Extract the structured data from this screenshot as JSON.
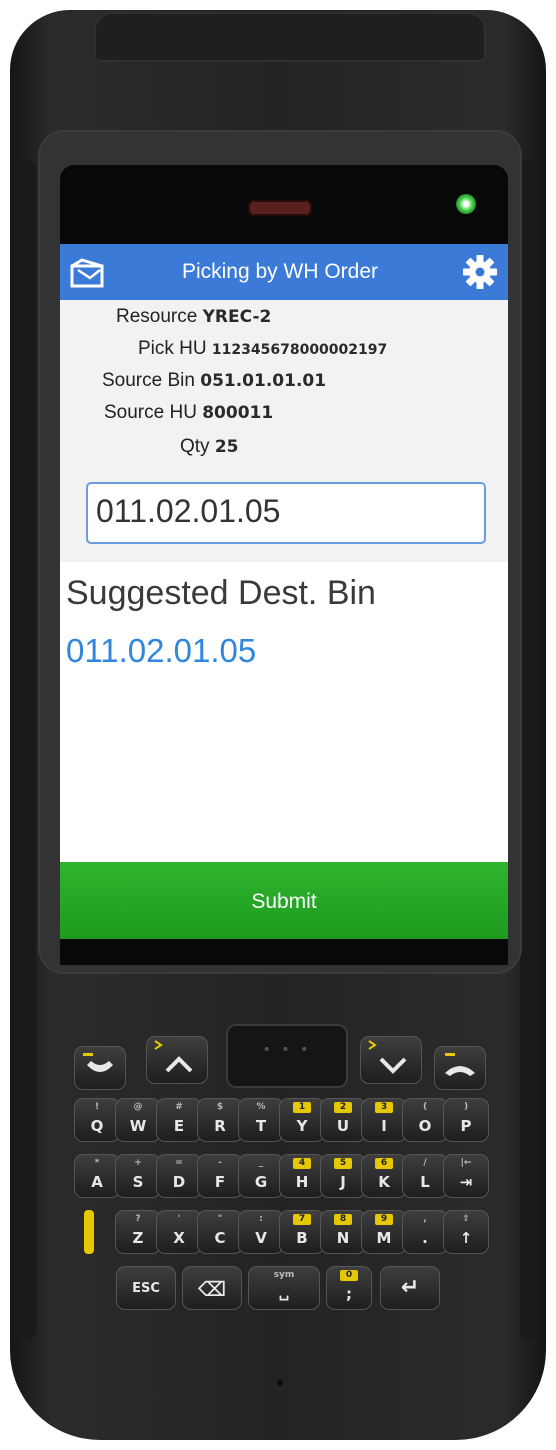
{
  "app": {
    "title": "Picking by WH Order",
    "icons": {
      "back": "exit-door-icon",
      "settings": "gear-icon"
    }
  },
  "details": [
    {
      "label": "Resource",
      "value": "YREC-2"
    },
    {
      "label": "Pick HU",
      "value": "112345678000002197"
    },
    {
      "label": "Source Bin",
      "value": "051.01.01.01"
    },
    {
      "label": "Source HU",
      "value": "800011"
    },
    {
      "label": "Qty",
      "value": "25"
    }
  ],
  "input": {
    "value": "011.02.01.05"
  },
  "suggested": {
    "label": "Suggested Dest. Bin",
    "value": "011.02.01.05"
  },
  "submit_label": "Submit",
  "keypad": {
    "row1": [
      {
        "main": "Q",
        "sub": "!"
      },
      {
        "main": "W",
        "sub": "@"
      },
      {
        "main": "E",
        "sub": "#"
      },
      {
        "main": "R",
        "sub": "$"
      },
      {
        "main": "T",
        "sub": "%"
      },
      {
        "main": "Y",
        "sub": "1"
      },
      {
        "main": "U",
        "sub": "2"
      },
      {
        "main": "I",
        "sub": "3"
      },
      {
        "main": "O",
        "sub": "("
      },
      {
        "main": "P",
        "sub": ")"
      }
    ],
    "row2": [
      {
        "main": "A",
        "sub": "*"
      },
      {
        "main": "S",
        "sub": "+"
      },
      {
        "main": "D",
        "sub": "="
      },
      {
        "main": "F",
        "sub": "-"
      },
      {
        "main": "G",
        "sub": "_"
      },
      {
        "main": "H",
        "sub": "4"
      },
      {
        "main": "J",
        "sub": "5"
      },
      {
        "main": "K",
        "sub": "6"
      },
      {
        "main": "L",
        "sub": "/"
      },
      {
        "main": "⇥",
        "sub": "|←"
      }
    ],
    "row3": [
      {
        "main": "Z",
        "sub": "?"
      },
      {
        "main": "X",
        "sub": "'"
      },
      {
        "main": "C",
        "sub": "\""
      },
      {
        "main": "V",
        "sub": ":"
      },
      {
        "main": "B",
        "sub": "7"
      },
      {
        "main": "N",
        "sub": "8"
      },
      {
        "main": "M",
        "sub": "9"
      },
      {
        "main": ".",
        "sub": ","
      },
      {
        "main": "↑",
        "sub": "⇧"
      }
    ],
    "row4": [
      {
        "main": "ESC",
        "sub": ""
      },
      {
        "main": "⌫",
        "sub": ""
      },
      {
        "main": "␣",
        "sub": "sym"
      },
      {
        "main": ";",
        "sub": "0"
      },
      {
        "main": "↵",
        "sub": ""
      }
    ]
  },
  "colors": {
    "header": "#3b7ad6",
    "submit": "#22a522",
    "suggested_value": "#2e86de",
    "led": "#45d34a"
  }
}
